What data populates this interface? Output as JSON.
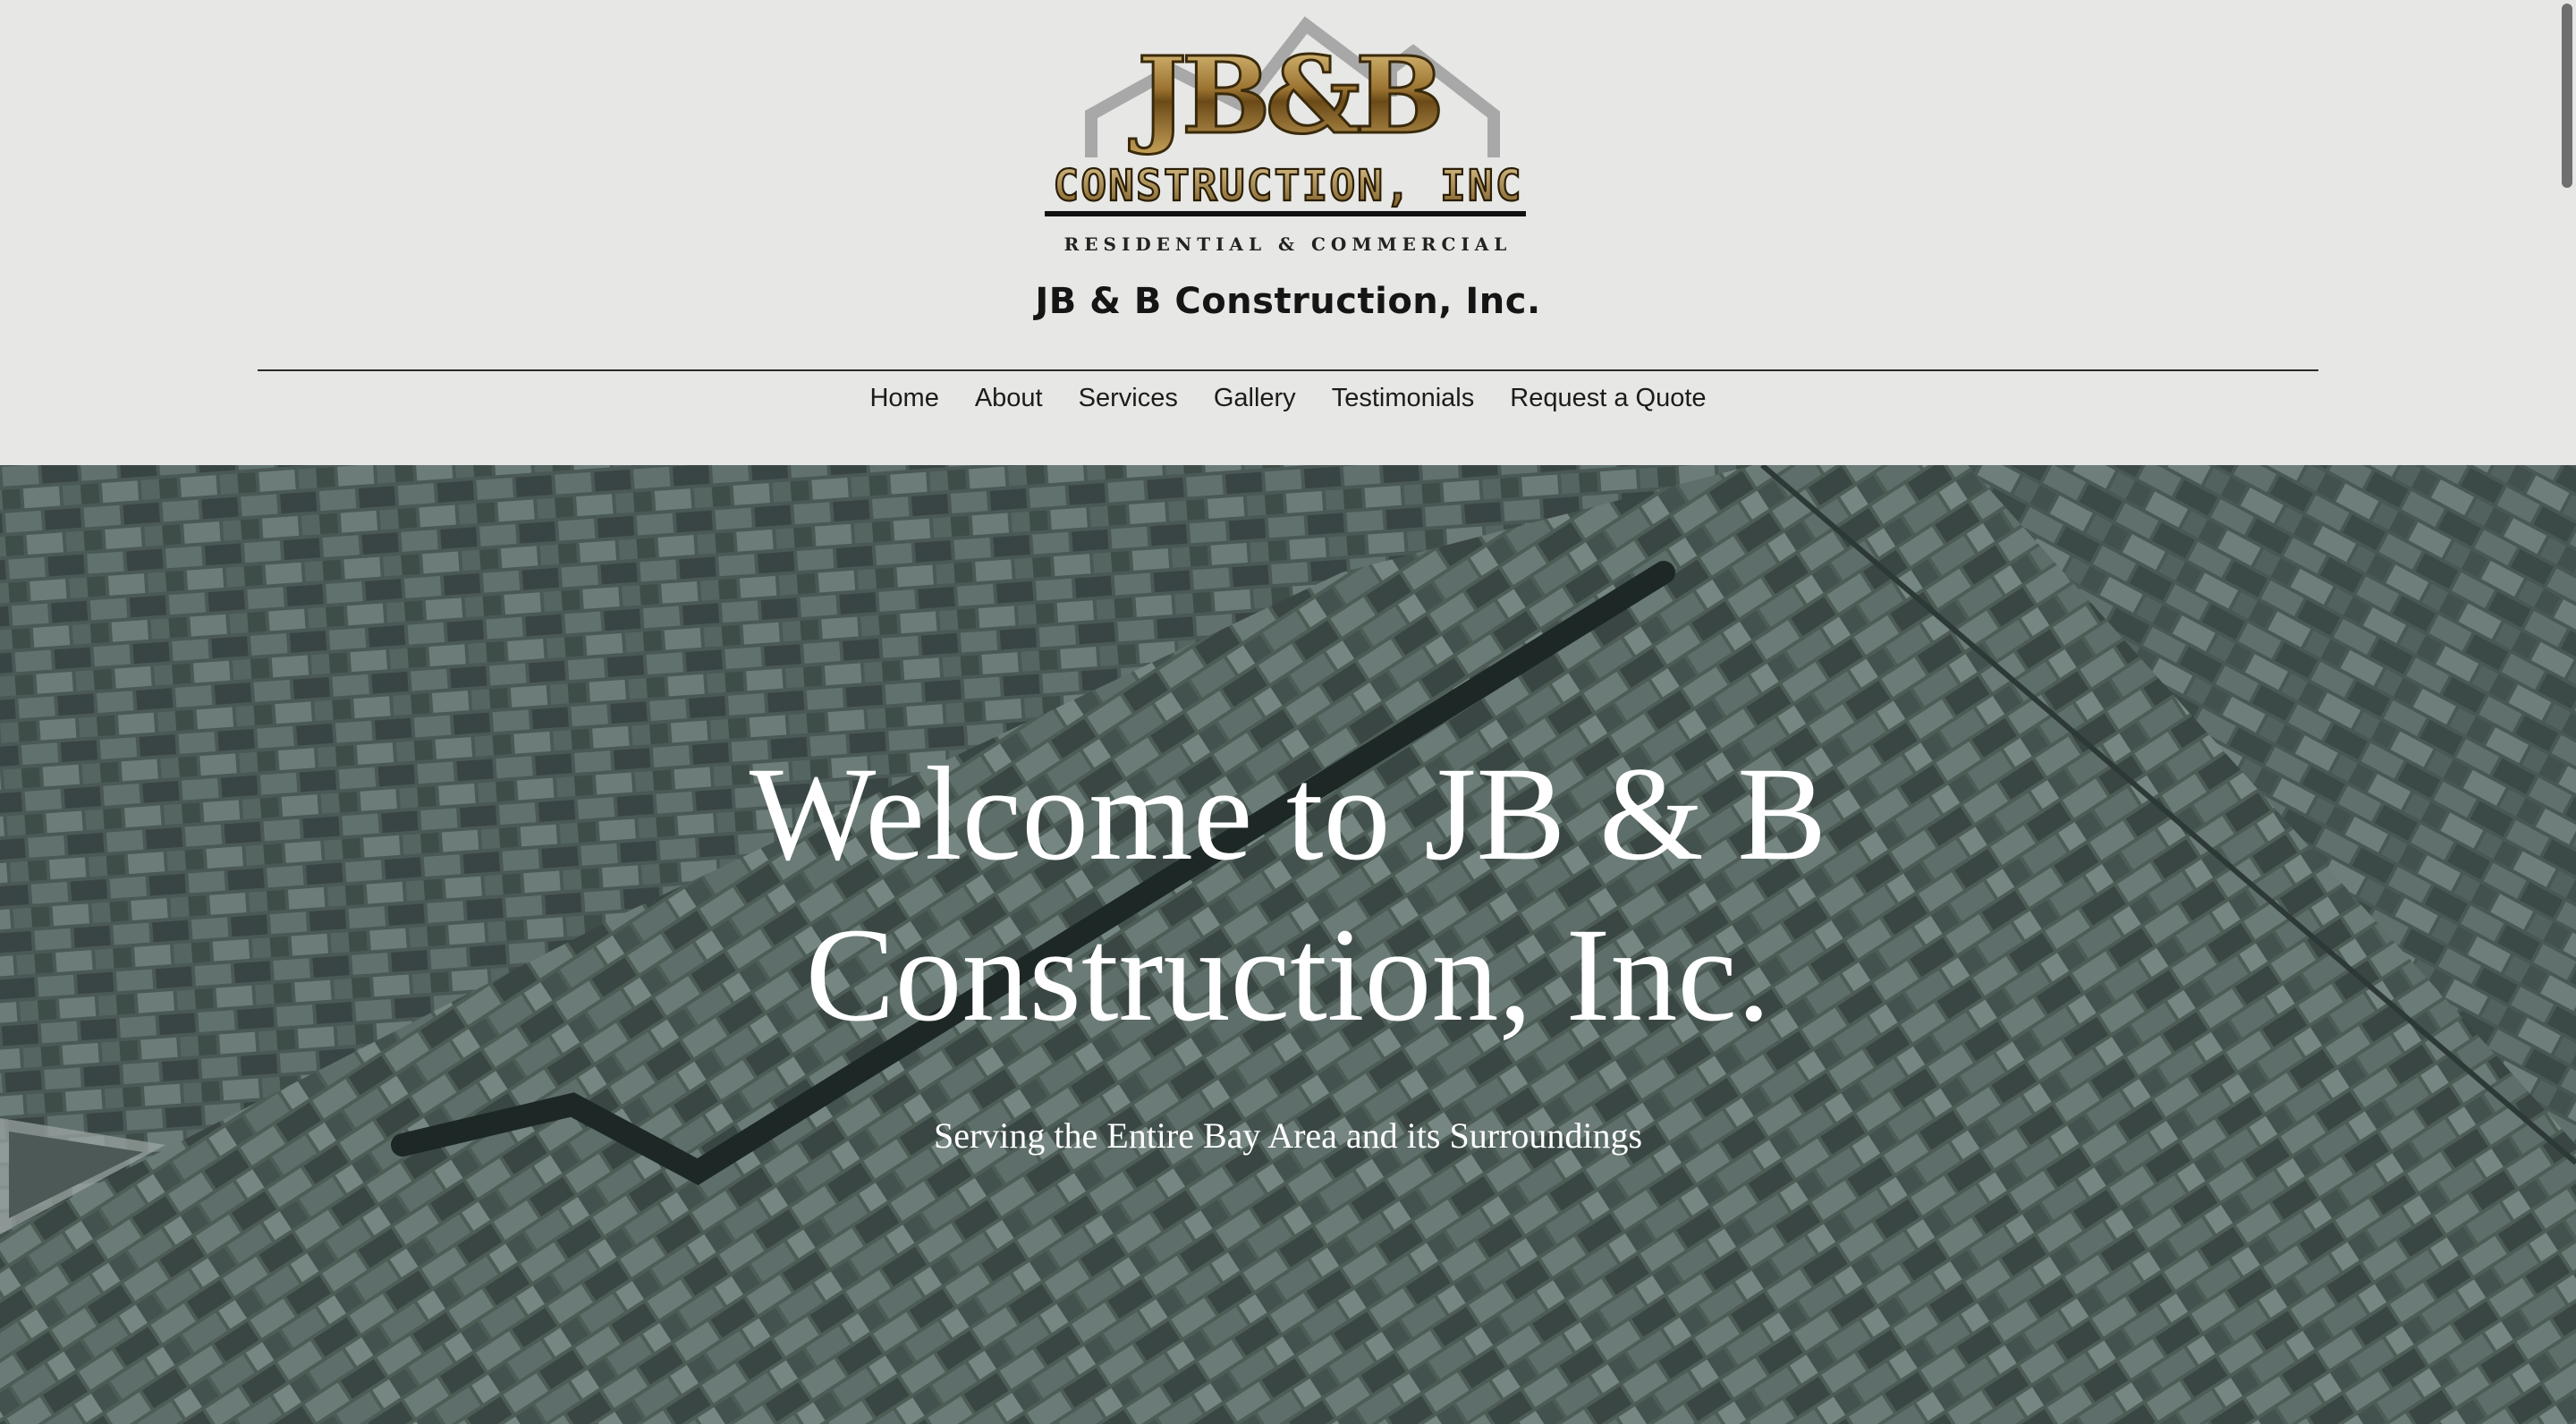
{
  "logo": {
    "monogram": "JB&B",
    "company": "CONSTRUCTION, INC",
    "tagline": "RESIDENTIAL & COMMERCIAL"
  },
  "header": {
    "site_title": "JB & B Construction, Inc."
  },
  "nav": {
    "items": [
      {
        "label": "Home"
      },
      {
        "label": "About"
      },
      {
        "label": "Services"
      },
      {
        "label": "Gallery"
      },
      {
        "label": "Testimonials"
      },
      {
        "label": "Request a Quote"
      }
    ]
  },
  "hero": {
    "heading_line1": "Welcome to JB & B",
    "heading_line2": "Construction, Inc.",
    "subheading": "Serving the Entire Bay Area and its Surroundings"
  },
  "colors": {
    "header_bg": "#e7e7e5",
    "roof_base": "#4f5f5c",
    "logo_gold": "#8a6a2a",
    "text_dark": "#151515"
  }
}
